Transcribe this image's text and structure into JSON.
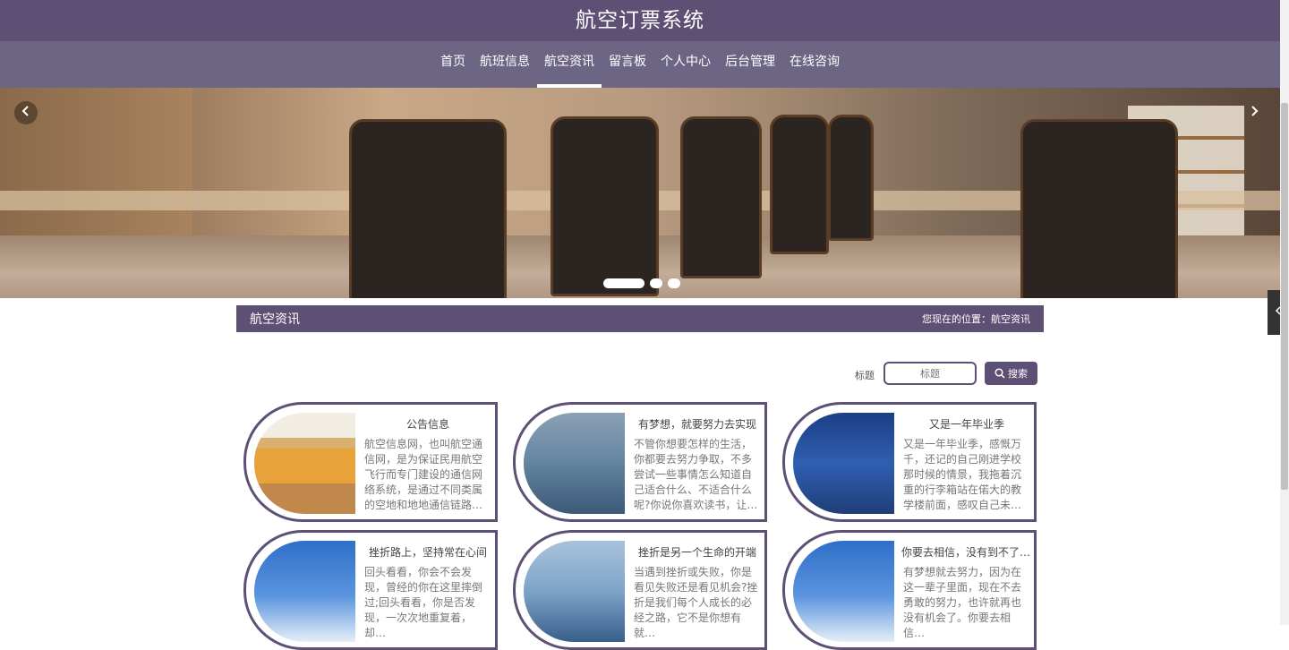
{
  "app": {
    "title": "航空订票系统"
  },
  "nav": {
    "items": [
      {
        "label": "首页"
      },
      {
        "label": "航班信息"
      },
      {
        "label": "航空资讯"
      },
      {
        "label": "留言板"
      },
      {
        "label": "个人中心"
      },
      {
        "label": "后台管理"
      },
      {
        "label": "在线咨询"
      }
    ],
    "active_label": "航空资讯"
  },
  "banner": {
    "prev_icon": "chevron-left-icon",
    "next_icon": "chevron-right-icon",
    "slide_count": 3,
    "active_slide": 1
  },
  "section": {
    "title": "航空资讯",
    "breadcrumb": "您现在的位置：航空资讯"
  },
  "search": {
    "label": "标题",
    "placeholder": "标题",
    "button_label": "搜索",
    "button_icon": "search-icon"
  },
  "cards": [
    {
      "title": "公告信息",
      "text": "航空信息网，也叫航空通信网，是为保证民用航空飞行而专门建设的通信网络系统，是通过不同类属的空地和地地通信链路…"
    },
    {
      "title": "有梦想，就要努力去实现",
      "text": "不管你想要怎样的生活，你都要去努力争取，不多尝试一些事情怎么知道自己适合什么、不适合什么呢?你说你喜欢读书，让…"
    },
    {
      "title": "又是一年毕业季",
      "text": "又是一年毕业季，感慨万千，还记的自己刚进学校那时候的情景，我拖着沉重的行李箱站在偌大的教学楼前面，感叹自己未…"
    },
    {
      "title": "挫折路上，坚持常在心间",
      "text": "回头看看，你会不会发现，曾经的你在这里摔倒过;回头看看，你是否发现，一次次地重复着，却…"
    },
    {
      "title": "挫折是另一个生命的开端",
      "text": "当遇到挫折或失败，你是看见失败还是看见机会?挫折是我们每个人成长的必经之路，它不是你想有就…"
    },
    {
      "title": "你要去相信，没有到不了的明天",
      "text": "有梦想就去努力，因为在这一辈子里面，现在不去勇敢的努力，也许就再也没有机会了。你要去相信…"
    }
  ],
  "side_tab": {
    "icon": "chevron-left-icon"
  },
  "colors": {
    "primary": "#5e4f74",
    "nav_bg": "#6c6584"
  }
}
